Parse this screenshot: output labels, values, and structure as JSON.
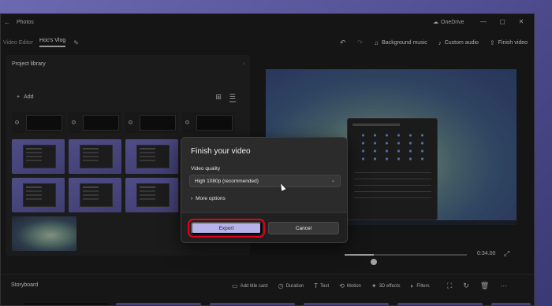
{
  "window": {
    "app_title": "Photos",
    "back_icon": "back-arrow-icon",
    "cloud_label": "OneDrive",
    "controls": [
      "—",
      "▢",
      "✕"
    ]
  },
  "toolbar": {
    "breadcrumb_root": "Video Editor",
    "project_name": "Hoc's Vlog",
    "background_music": "Background music",
    "custom_audio": "Custom audio",
    "finish_video": "Finish video"
  },
  "library": {
    "title": "Project library",
    "add_label": "Add"
  },
  "player": {
    "duration": "0:34.00",
    "progress": 0.24
  },
  "storyboard": {
    "title": "Storyboard",
    "tools": [
      {
        "icon": "title-card-icon",
        "glyph": "▭",
        "label": "Add title card"
      },
      {
        "icon": "clock-icon",
        "glyph": "◷",
        "label": "Duration"
      },
      {
        "icon": "text-icon",
        "glyph": "T",
        "label": "Text"
      },
      {
        "icon": "motion-icon",
        "glyph": "⟲",
        "label": "Motion"
      },
      {
        "icon": "effects-icon",
        "glyph": "✦",
        "label": "3D effects"
      },
      {
        "icon": "filters-icon",
        "glyph": "◐",
        "label": "Filters"
      }
    ]
  },
  "dialog": {
    "title": "Finish your video",
    "quality_label": "Video quality",
    "quality_value": "High 1080p (recommended)",
    "more_options": "More options",
    "export_label": "Export",
    "cancel_label": "Cancel"
  },
  "colors": {
    "accent": "#b7b3ea",
    "highlight": "#e3001b"
  }
}
